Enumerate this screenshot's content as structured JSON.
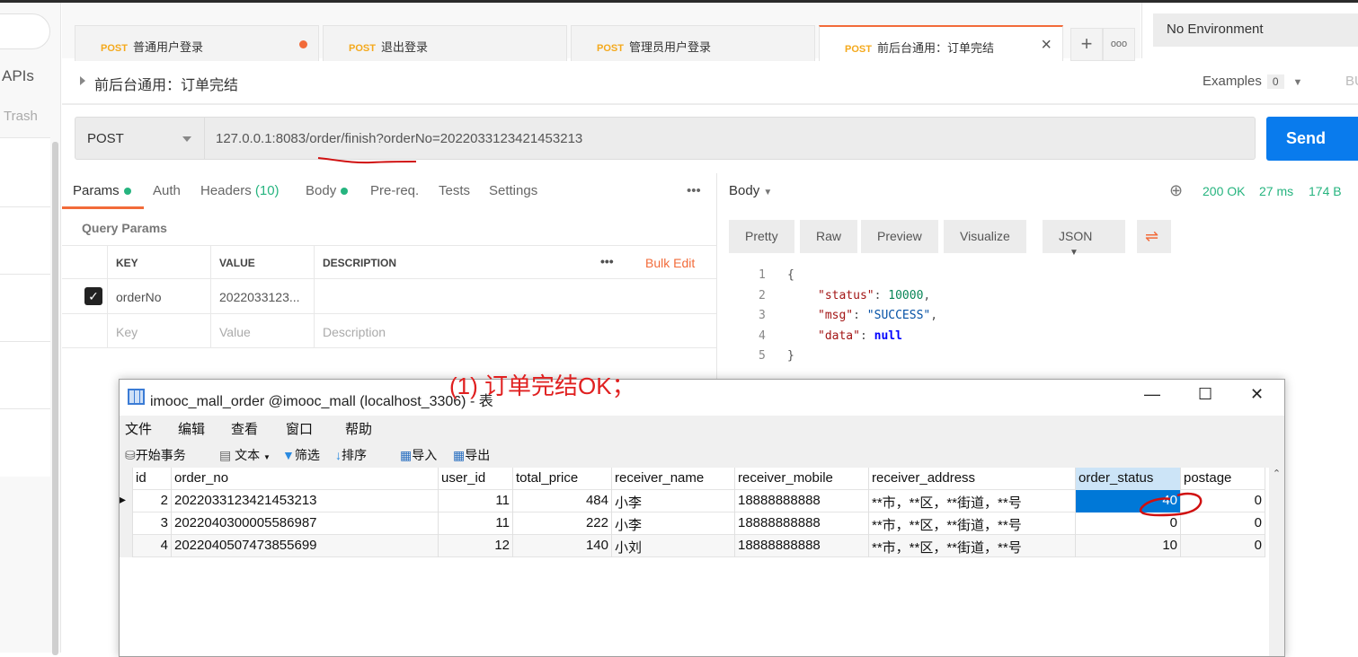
{
  "sidebar": {
    "apis": "APIs",
    "trash": "Trash"
  },
  "tabs": [
    {
      "method": "POST",
      "label": "普通用户登录",
      "unsaved": true
    },
    {
      "method": "POST",
      "label": "退出登录"
    },
    {
      "method": "POST",
      "label": "管理员用户登录"
    },
    {
      "method": "POST",
      "label": "前后台通用：订单完结",
      "active": true
    }
  ],
  "tab_actions": {
    "add": "+",
    "more": "ooo"
  },
  "environment": "No Environment",
  "request": {
    "title": "前后台通用：订单完结",
    "examples_label": "Examples",
    "examples_count": "0",
    "bulk_label": "BU",
    "method": "POST",
    "url": "127.0.0.1:8083/order/finish?orderNo=2022033123421453213",
    "send": "Send"
  },
  "req_tabs": {
    "params": "Params",
    "auth": "Auth",
    "headers": "Headers",
    "headers_count": "(10)",
    "body": "Body",
    "prereq": "Pre-req.",
    "tests": "Tests",
    "settings": "Settings",
    "more": "•••"
  },
  "params": {
    "section": "Query Params",
    "col_key": "KEY",
    "col_value": "VALUE",
    "col_desc": "DESCRIPTION",
    "more": "•••",
    "bulk_edit": "Bulk Edit",
    "rows": [
      {
        "checked": true,
        "key": "orderNo",
        "value": "2022033123..."
      }
    ],
    "placeholder": {
      "key": "Key",
      "value": "Value",
      "desc": "Description"
    }
  },
  "response": {
    "body_label": "Body",
    "status": "200 OK",
    "time": "27 ms",
    "size": "174 B",
    "views": [
      "Pretty",
      "Raw",
      "Preview",
      "Visualize"
    ],
    "format": "JSON",
    "lines": [
      "1",
      "2",
      "3",
      "4",
      "5"
    ],
    "json": {
      "status_key": "\"status\"",
      "status_val": "10000",
      "msg_key": "\"msg\"",
      "msg_val": "\"SUCCESS\"",
      "data_key": "\"data\"",
      "data_val": "null"
    }
  },
  "annotation": "(1) 订单完结OK；",
  "db_window": {
    "title": "imooc_mall_order @imooc_mall (localhost_3306) - 表",
    "menu": [
      "文件",
      "编辑",
      "查看",
      "窗口",
      "帮助"
    ],
    "toolbar": [
      "开始事务",
      "文本",
      "筛选",
      "排序",
      "导入",
      "导出"
    ],
    "columns": [
      "id",
      "order_no",
      "user_id",
      "total_price",
      "receiver_name",
      "receiver_mobile",
      "receiver_address",
      "order_status",
      "postage"
    ],
    "rows": [
      [
        "2",
        "2022033123421453213",
        "11",
        "484",
        "小李",
        "18888888888",
        "**市，**区，**街道，**号",
        "40",
        "0"
      ],
      [
        "3",
        "2022040300005586987",
        "11",
        "222",
        "小李",
        "18888888888",
        "**市，**区，**街道，**号",
        "0",
        "0"
      ],
      [
        "4",
        "2022040507473855699",
        "12",
        "140",
        "小刘",
        "18888888888",
        "**市，**区，**街道，**号",
        "10",
        "0"
      ]
    ]
  },
  "colors": {
    "accent": "#f26b3a",
    "send": "#097bed",
    "success": "#26b47f",
    "selected": "#0078d7",
    "annotation": "#e02020"
  }
}
